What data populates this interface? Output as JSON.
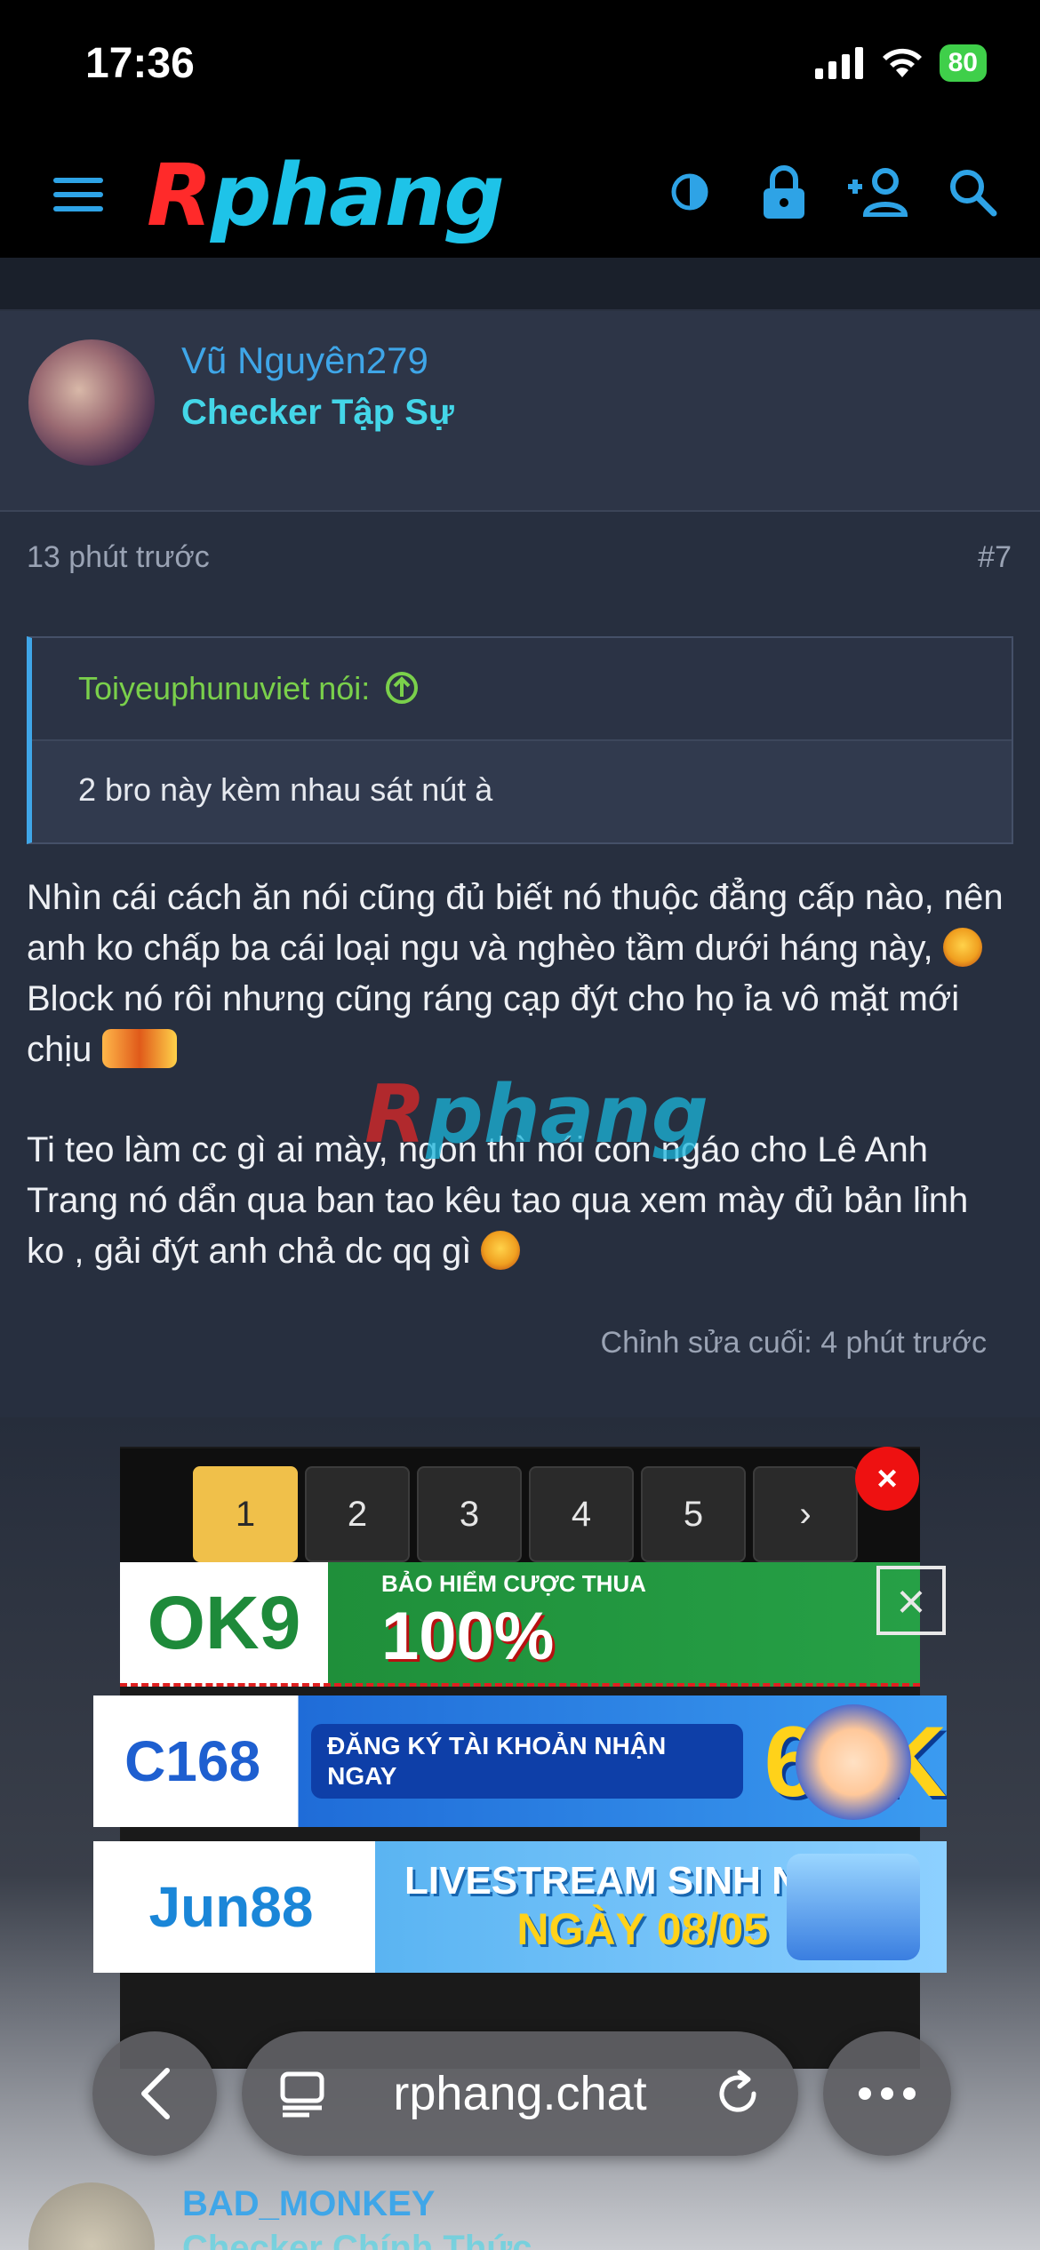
{
  "status": {
    "time": "17:36",
    "battery": "80"
  },
  "header": {
    "logo_r": "R",
    "logo_rest": "phang"
  },
  "post": {
    "username": "Vũ Nguyên279",
    "user_title": "Checker Tập Sự",
    "time": "13 phút trước",
    "number": "#7",
    "quote_author": "Toiyeuphunuviet nói:",
    "quote_text": "2 bro này kèm nhau sát nút à",
    "body_p1_a": "Nhìn cái cách ăn nói cũng đủ biết nó thuộc đẳng cấp nào, nên anh ko chấp ba cái loại ngu và nghèo tầm dưới háng này,",
    "body_p1_b": "Block nó rôi nhưng cũng ráng cạp đýt cho họ ỉa vô mặt mới chịu",
    "body_p2": "Ti teo làm cc gì ai mày, ngon thì nói con ngáo cho Lê Anh Trang nó dẩn qua ban tao kêu tao qua xem mày đủ bản lỉnh ko , gải đýt anh chả dc qq gì",
    "edited": "Chỉnh sửa cuối: 4 phút trước",
    "watermark_r": "R",
    "watermark_rest": "phang"
  },
  "pager": {
    "pages": [
      "1",
      "2",
      "3",
      "4",
      "5"
    ],
    "next": "›",
    "active": "1"
  },
  "ads": {
    "ok9_logo": "OK9",
    "ok9_small": "BẢO HIỂM CƯỢC THUA",
    "ok9_big": "100%",
    "c168_logo": "C168",
    "c168_pill": "ĐĂNG KÝ TÀI KHOẢN NHẬN NGAY",
    "c168_big": "68K",
    "jun88_logo": "Jun88",
    "jun88_l1": "LIVESTREAM SINH NHẬT",
    "jun88_l2": "NGÀY 08/05"
  },
  "next_post": {
    "username": "BAD_MONKEY",
    "user_title": "Checker Chính Thức"
  },
  "browser": {
    "url": "rphang.chat"
  },
  "colors": {
    "accent": "#3fa6e8",
    "user_title": "#44d6e8",
    "quote_author": "#7ad04b",
    "background": "#272f3f"
  }
}
